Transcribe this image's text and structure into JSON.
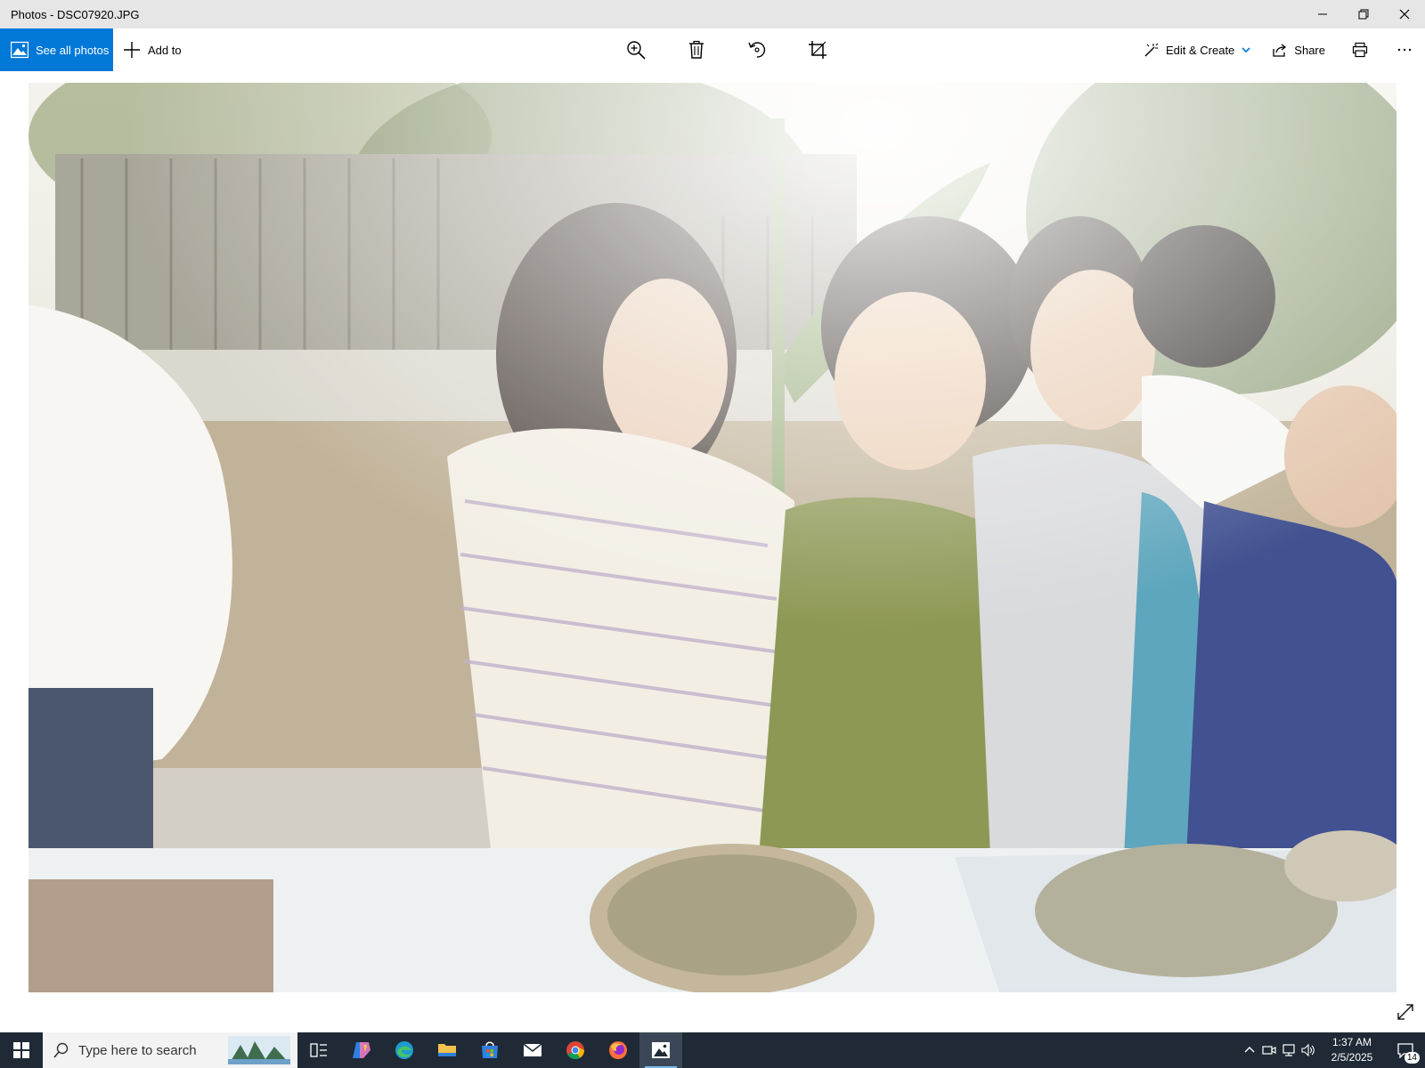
{
  "window": {
    "title": "Photos - DSC07920.JPG"
  },
  "toolbar": {
    "see_all_label": "See all photos",
    "add_to_label": "Add to",
    "edit_create_label": "Edit & Create",
    "share_label": "Share"
  },
  "icons": {
    "zoom": "zoom-in-icon",
    "delete": "trash-icon",
    "rotate": "rotate-icon",
    "crop": "crop-icon",
    "print": "printer-icon",
    "more": "more-icon"
  },
  "photo": {
    "filename": "DSC07920.JPG"
  },
  "taskbar": {
    "search_placeholder": "Type here to search",
    "apps": [
      "task-view",
      "copilot",
      "edge",
      "file-explorer",
      "microsoft-store",
      "mail",
      "chrome",
      "firefox",
      "photos"
    ],
    "clock_time": "1:37 AM",
    "clock_date": "2/5/2025",
    "notification_count": "14"
  },
  "colors": {
    "accent": "#0078d7",
    "taskbar": "#1f2a36",
    "titlebar": "#e6e6e6"
  }
}
